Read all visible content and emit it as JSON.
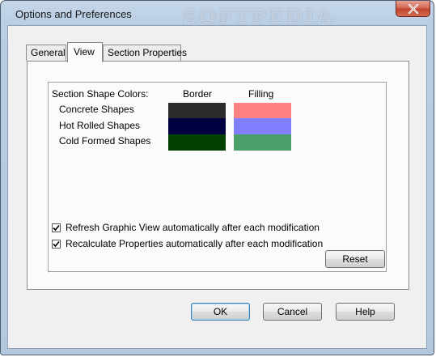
{
  "window": {
    "title": "Options and Preferences",
    "watermark": "SOFTPEDIA"
  },
  "tabs": [
    {
      "label": "General",
      "active": false
    },
    {
      "label": "View",
      "active": true
    },
    {
      "label": "Section Properties",
      "active": false
    }
  ],
  "colors_section": {
    "heading": "Section Shape Colors:",
    "border_header": "Border",
    "filling_header": "Filling",
    "rows": [
      {
        "label": "Concrete Shapes",
        "border_color": "#2b2b2b",
        "fill_color": "#ff8080"
      },
      {
        "label": "Hot Rolled Shapes",
        "border_color": "#000040",
        "fill_color": "#8080ff"
      },
      {
        "label": "Cold Formed Shapes",
        "border_color": "#004000",
        "fill_color": "#4aa068"
      }
    ]
  },
  "options": [
    {
      "label": "Refresh Graphic View automatically after each modification",
      "checked": true
    },
    {
      "label": "Recalculate Properties automatically after each modification",
      "checked": true
    }
  ],
  "buttons": {
    "reset": "Reset",
    "ok": "OK",
    "cancel": "Cancel",
    "help": "Help"
  }
}
